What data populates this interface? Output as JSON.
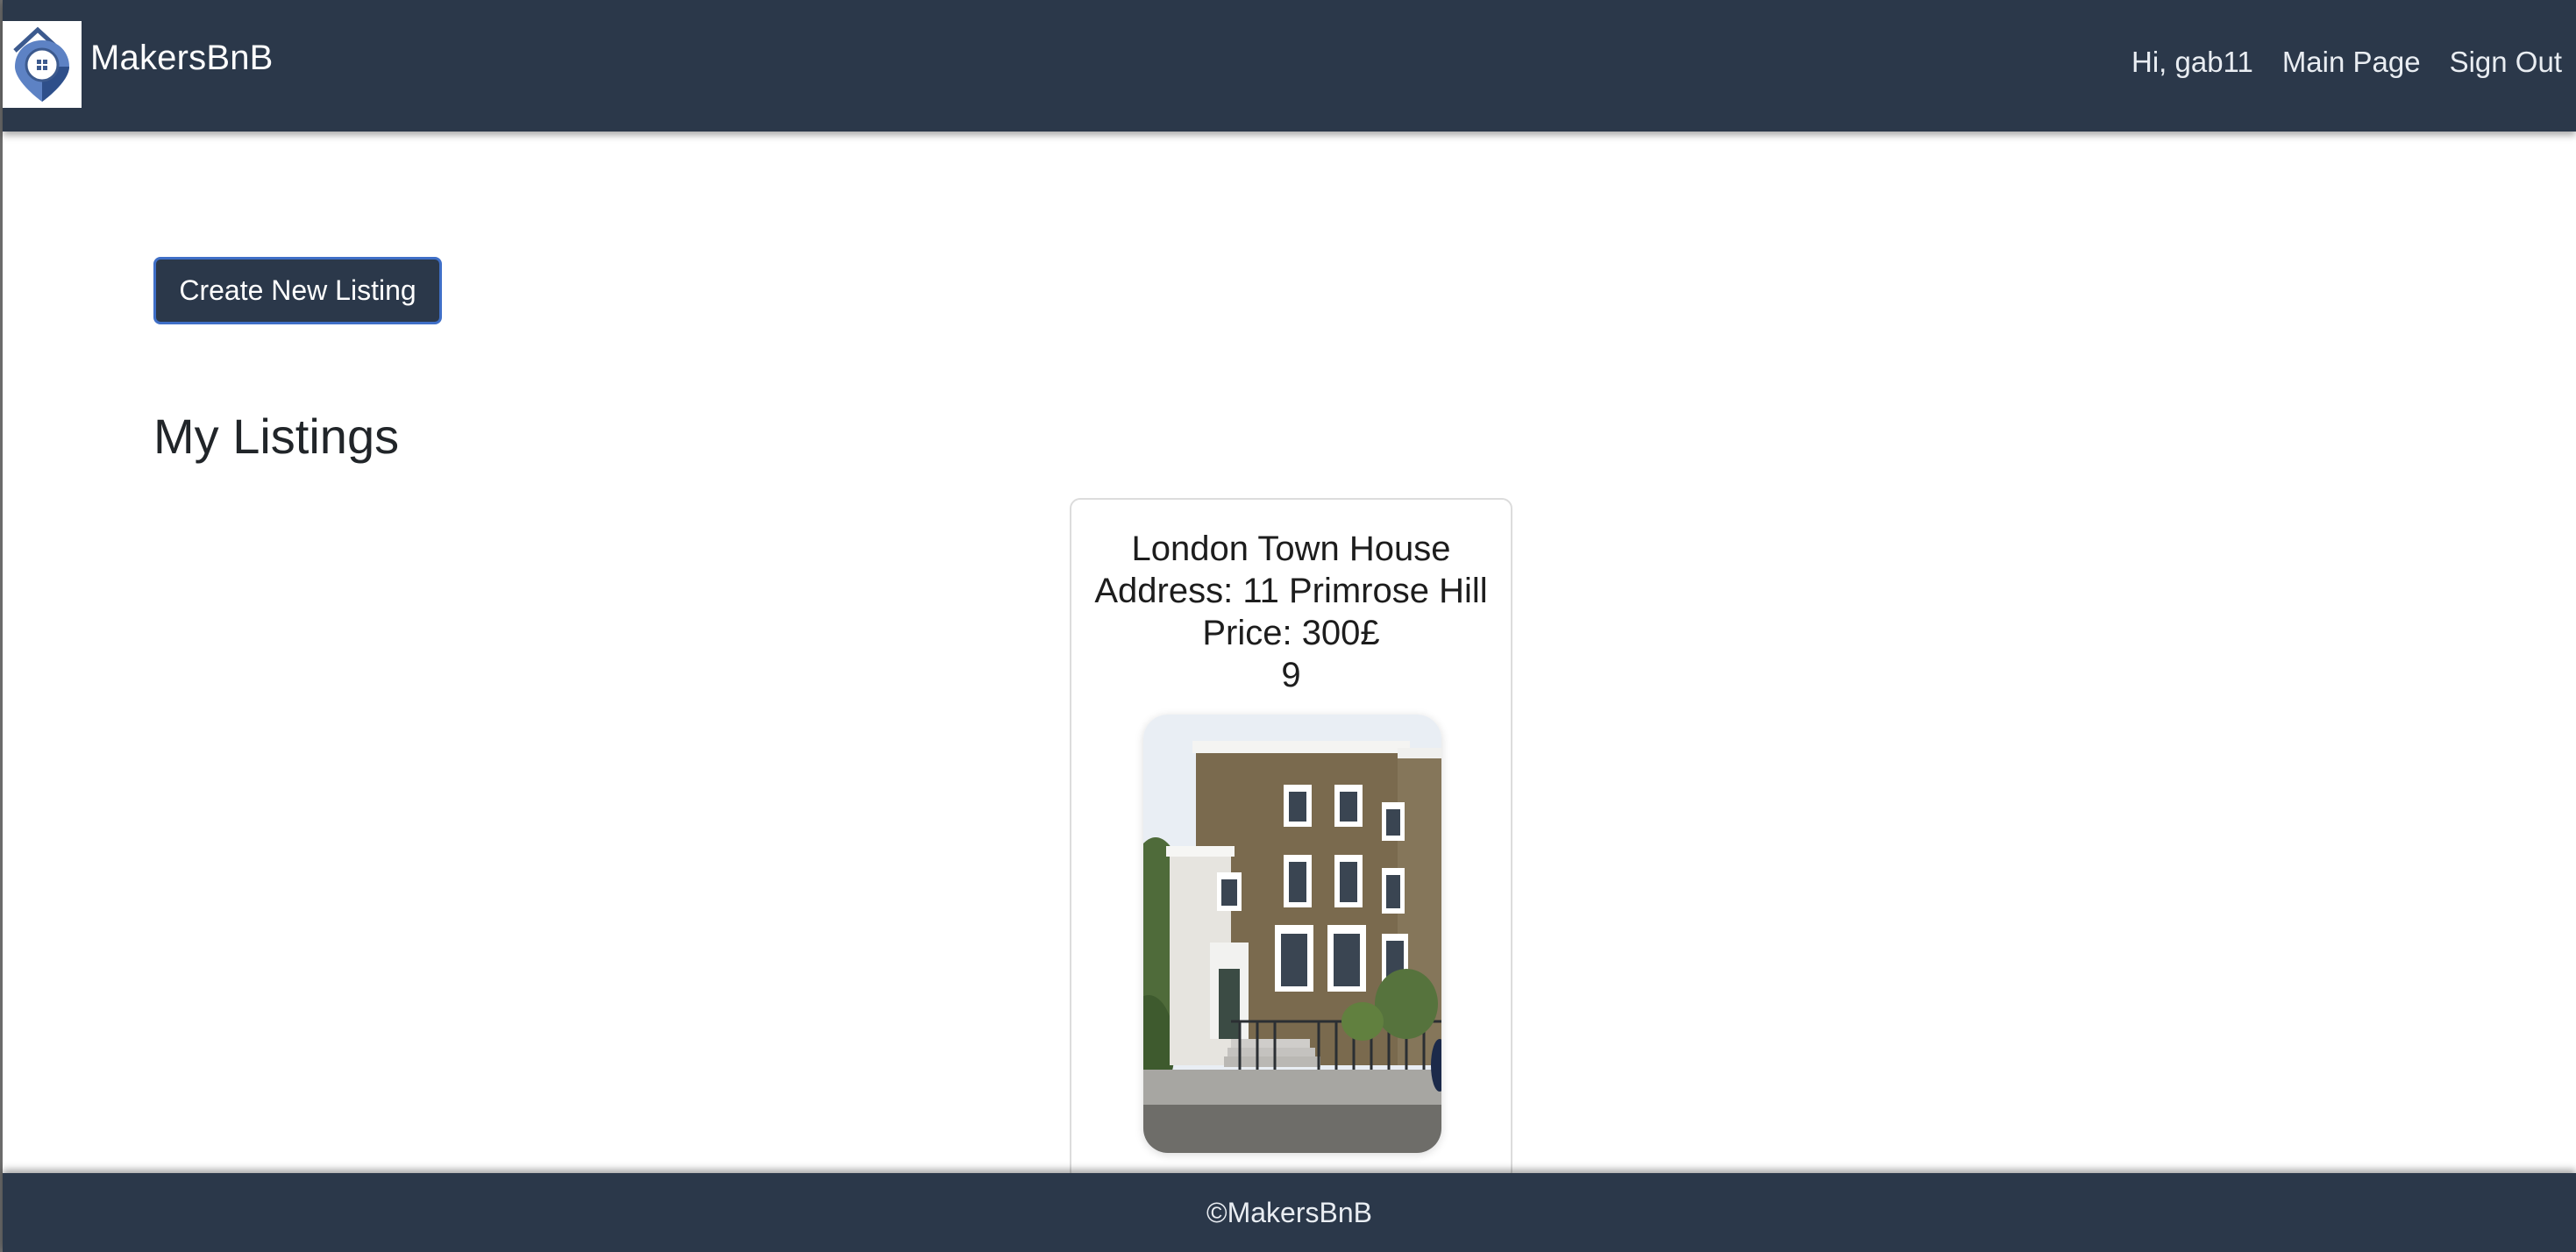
{
  "header": {
    "brand_name": "MakersBnB",
    "greeting": "Hi, gab11",
    "main_page_link": "Main Page",
    "sign_out_link": "Sign Out"
  },
  "main": {
    "create_button_label": "Create New Listing",
    "section_title": "My Listings",
    "listings": [
      {
        "name": "London Town House",
        "address": "Address: 11 Primrose Hill",
        "price": "Price: 300£",
        "extra": "9",
        "photo_icon": "town-house-photo"
      }
    ]
  },
  "footer": {
    "text": "©MakersBnB"
  },
  "colors": {
    "navbar": "#2b384a",
    "button_border": "#3f6fc7",
    "logo_blue": "#4a6fb0"
  }
}
